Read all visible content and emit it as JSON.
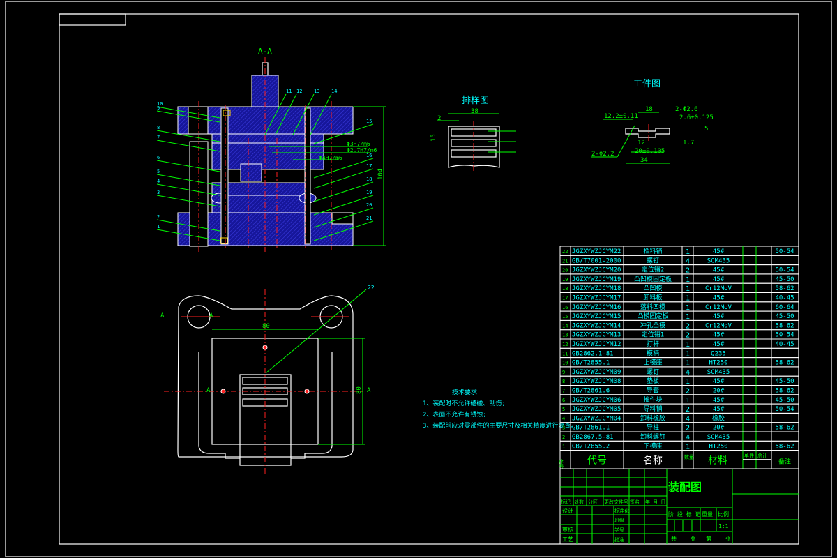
{
  "section_view": {
    "title": "A-A",
    "height_dim": "104",
    "fits": [
      "Φ3H7/m6",
      "Φ2.7H7/m6",
      "Φ4H7/m6"
    ],
    "left_callouts": [
      "10",
      "9",
      "8",
      "7",
      "6",
      "5",
      "4",
      "3",
      "2",
      "1"
    ],
    "top_callouts": [
      "11",
      "12",
      "13",
      "14"
    ],
    "right_callouts": [
      "15",
      "16",
      "17",
      "18",
      "19",
      "20",
      "21"
    ]
  },
  "plan_view": {
    "width_dim": "80",
    "height_dim": "80",
    "callout": "22",
    "section_marks": [
      "A",
      "A",
      "A",
      "A"
    ]
  },
  "strip_layout": {
    "title": "排样图",
    "width_dim": "38",
    "edge_dim": "2",
    "pitch_dim": "15"
  },
  "workpiece": {
    "title": "工件图",
    "dims": [
      "18",
      "12.2±0.11",
      "2-Φ2.6",
      "2.6±0.125",
      "12",
      "20±0.105",
      "34",
      "1.7",
      "2-Φ2.2",
      "5"
    ]
  },
  "tech_requirements": {
    "title": "技术要求",
    "items": [
      "1、装配时不允许磕碰、刮伤;",
      "2、表面不允许有锈蚀;",
      "3、装配前应对零部件的主要尺寸及相关精度进行复查。"
    ]
  },
  "bom": {
    "header": {
      "no": "序号",
      "code": "代号",
      "name": "名称",
      "qty": "数量",
      "material": "材料",
      "unit_weight": "单件",
      "total_weight": "总计",
      "remark": "备注"
    },
    "rows": [
      {
        "no": "22",
        "code": "JGZXYWZJCYM22",
        "name": "挡料销",
        "qty": "1",
        "material": "45#",
        "remark": "50-54"
      },
      {
        "no": "21",
        "code": "GB/T7001-2000",
        "name": "螺钉",
        "qty": "4",
        "material": "SCM435",
        "remark": ""
      },
      {
        "no": "20",
        "code": "JGZXYWZJCYM20",
        "name": "定位销2",
        "qty": "2",
        "material": "45#",
        "remark": "50-54"
      },
      {
        "no": "19",
        "code": "JGZXYWZJCYM19",
        "name": "凸凹模固定板",
        "qty": "1",
        "material": "45#",
        "remark": "45-50"
      },
      {
        "no": "18",
        "code": "JGZXYWZJCYM18",
        "name": "凸凹模",
        "qty": "1",
        "material": "Cr12MoV",
        "remark": "58-62"
      },
      {
        "no": "17",
        "code": "JGZXYWZJCYM17",
        "name": "卸料板",
        "qty": "1",
        "material": "45#",
        "remark": "40-45"
      },
      {
        "no": "16",
        "code": "JGZXYWZJCYM16",
        "name": "落料凹模",
        "qty": "1",
        "material": "Cr12MoV",
        "remark": "60-64"
      },
      {
        "no": "15",
        "code": "JGZXYWZJCYM15",
        "name": "凸模固定板",
        "qty": "1",
        "material": "45#",
        "remark": "45-50"
      },
      {
        "no": "14",
        "code": "JGZXYWZJCYM14",
        "name": "冲孔凸模",
        "qty": "2",
        "material": "Cr12MoV",
        "remark": "58-62"
      },
      {
        "no": "13",
        "code": "JGZXYWZJCYM13",
        "name": "定位销1",
        "qty": "2",
        "material": "45#",
        "remark": "50-54"
      },
      {
        "no": "12",
        "code": "JGZXYWZJCYM12",
        "name": "打杆",
        "qty": "1",
        "material": "45#",
        "remark": "40-45"
      },
      {
        "no": "11",
        "code": "GB2862.1-81",
        "name": "模柄",
        "qty": "1",
        "material": "Q235",
        "remark": ""
      },
      {
        "no": "10",
        "code": "GB/T2855.1",
        "name": "上模座",
        "qty": "1",
        "material": "HT250",
        "remark": "58-62"
      },
      {
        "no": "9",
        "code": "JGZXYWZJCYM09",
        "name": "螺钉",
        "qty": "4",
        "material": "SCM435",
        "remark": ""
      },
      {
        "no": "8",
        "code": "JGZXYWZJCYM08",
        "name": "垫板",
        "qty": "1",
        "material": "45#",
        "remark": "45-50"
      },
      {
        "no": "7",
        "code": "GB/T2861.6",
        "name": "导套",
        "qty": "2",
        "material": "20#",
        "remark": "58-62"
      },
      {
        "no": "6",
        "code": "JGZXYWZJCYM06",
        "name": "推件块",
        "qty": "1",
        "material": "45#",
        "remark": "45-50"
      },
      {
        "no": "5",
        "code": "JGZXYWZJCYM05",
        "name": "导料销",
        "qty": "2",
        "material": "45#",
        "remark": "50-54"
      },
      {
        "no": "4",
        "code": "JGZXYWZJCYM04",
        "name": "卸料橡胶",
        "qty": "4",
        "material": "橡胶",
        "remark": ""
      },
      {
        "no": "3",
        "code": "GB/T2861.1",
        "name": "导柱",
        "qty": "2",
        "material": "20#",
        "remark": "58-62"
      },
      {
        "no": "2",
        "code": "GB2867.5-81",
        "name": "卸料螺钉",
        "qty": "4",
        "material": "SCM435",
        "remark": ""
      },
      {
        "no": "1",
        "code": "GB/T2855.2",
        "name": "下模座",
        "qty": "1",
        "material": "HT250",
        "remark": "58-62"
      }
    ]
  },
  "title_block": {
    "drawing_name": "装配图",
    "rev_headers": [
      "标记",
      "处数",
      "分区",
      "更改文件号",
      "签名",
      "年 月 日"
    ],
    "roles": [
      "设计",
      "审核",
      "工艺"
    ],
    "mid_labels": [
      "标准化",
      "班级",
      "学号",
      "批准"
    ],
    "stage_header": "阶 段 标 记",
    "weight_header": "重量",
    "scale_header": "比例",
    "scale_value": "1:1",
    "sheet_text": [
      "共",
      "张",
      "第",
      "张"
    ]
  },
  "colors": {
    "line": "#ffffff",
    "dim": "#00ff00",
    "text": "#00ffff",
    "center": "#ff2020",
    "section_fill": "#1a1aa0"
  }
}
